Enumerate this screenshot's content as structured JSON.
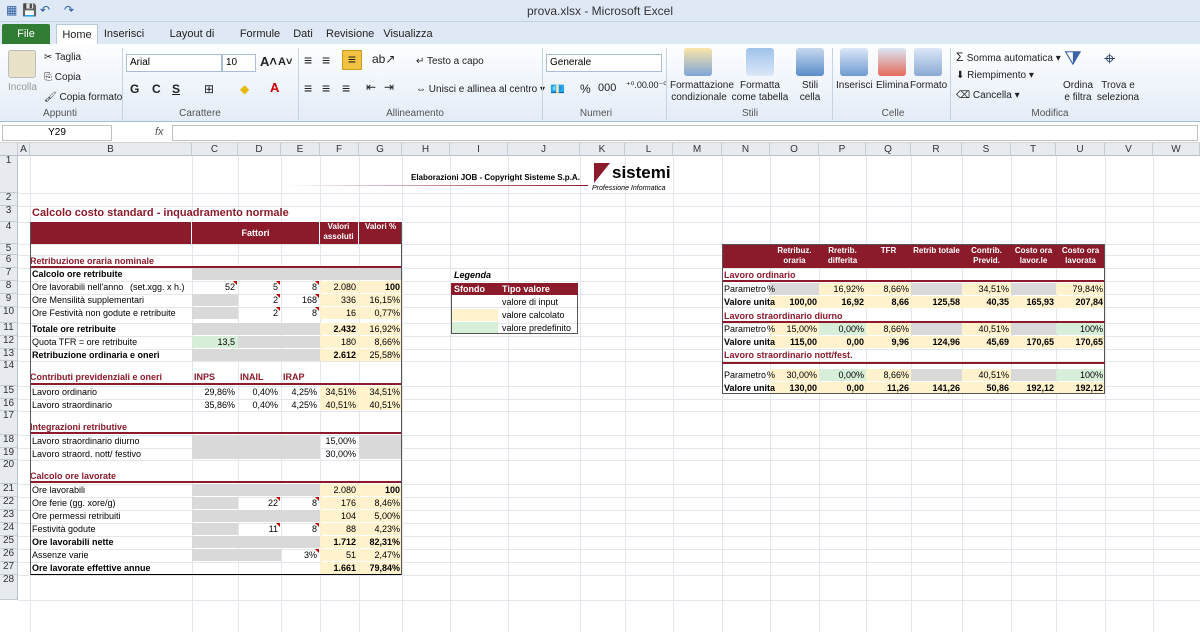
{
  "window": {
    "title": "prova.xlsx  -  Microsoft Excel"
  },
  "tabs": [
    "File",
    "Home",
    "Inserisci",
    "Layout di pagina",
    "Formule",
    "Dati",
    "Revisione",
    "Visualizza"
  ],
  "ribbon": {
    "clipboard": {
      "paste": "Incolla",
      "cut": "Taglia",
      "copy": "Copia",
      "format_painter": "Copia formato",
      "label": "Appunti"
    },
    "font": {
      "name": "Arial",
      "size": "10",
      "bold": "G",
      "italic": "C",
      "underline": "S",
      "label": "Carattere"
    },
    "alignment": {
      "wrap": "Testo a capo",
      "merge": "Unisci e allinea al centro",
      "label": "Allineamento"
    },
    "number": {
      "format": "Generale",
      "pct": "%",
      "thousands": "000",
      "label": "Numeri"
    },
    "styles": {
      "cond": "Formattazione",
      "cond2": "condizionale",
      "table": "Formatta",
      "table2": "come tabella",
      "cell": "Stili",
      "cell2": "cella",
      "label": "Stili"
    },
    "cells": {
      "insert": "Inserisci",
      "delete": "Elimina",
      "format": "Formato",
      "label": "Celle"
    },
    "editing": {
      "autosum": "Somma automatica",
      "fill": "Riempimento",
      "clear": "Cancella",
      "sort": "Ordina",
      "sort2": "e filtra",
      "find": "Trova e",
      "find2": "seleziona",
      "label": "Modifica"
    }
  },
  "formula": {
    "name_box": "Y29",
    "fx": "fx"
  },
  "columns": [
    "A",
    "B",
    "C",
    "D",
    "E",
    "F",
    "G",
    "H",
    "I",
    "J",
    "K",
    "L",
    "M",
    "N",
    "O",
    "P",
    "Q",
    "R",
    "S",
    "T",
    "U",
    "V",
    "W"
  ],
  "rows": [
    "1",
    "2",
    "3",
    "4",
    "5",
    "6",
    "7",
    "8",
    "9",
    "10",
    "11",
    "12",
    "13",
    "14",
    "15",
    "16",
    "17",
    "18",
    "19",
    "20",
    "21",
    "22",
    "23",
    "24",
    "25",
    "26",
    "27",
    "28"
  ],
  "sheet": {
    "banner": "Elaborazioni JOB - Copyright Sisteme S.p.A.",
    "logo": "sistemi",
    "logo_sub": "Professione Informatica",
    "title": "Calcolo costo standard - inquadramento normale",
    "hdr_fattori": "Fattori",
    "hdr_valori_ass": "Valori assoluti",
    "hdr_valori_pct": "Valori %",
    "s1": "Retribuzione oraria nominale",
    "r5": "Calcolo ore retribuite",
    "r6": {
      "label": "Ore lavorabili nell'anno",
      "note": "(set.xgg. x h.)",
      "c": "52",
      "d": "5",
      "e": "8",
      "f": "2.080",
      "g": "100"
    },
    "r7": {
      "label": "Ore Mensilità supplementari",
      "d": "2",
      "e": "168",
      "f": "336",
      "g": "16,15%"
    },
    "r8": {
      "label": "Ore Festività non godute e retribuite",
      "d": "2",
      "e": "8",
      "f": "16",
      "g": "0,77%"
    },
    "r9": {
      "label": "Totale ore retribuite",
      "f": "2.432",
      "g": "16,92%"
    },
    "r10": {
      "label": "Quota TFR = ore retribuite",
      "c": "13,5",
      "f": "180",
      "g": "8,66%"
    },
    "r11": {
      "label": "Retribuzione ordinaria e oneri",
      "f": "2.612",
      "g": "25,58%"
    },
    "s2": "Contributi previdenziali e oneri",
    "s2_inps": "INPS",
    "s2_inail": "INAIL",
    "s2_irap": "IRAP",
    "r13": {
      "label": "Lavoro ordinario",
      "c": "29,86%",
      "d": "0,40%",
      "e": "4,25%",
      "f": "34,51%",
      "g": "34,51%"
    },
    "r14": {
      "label": "Lavoro straordinario",
      "c": "35,86%",
      "d": "0,40%",
      "e": "4,25%",
      "f": "40,51%",
      "g": "40,51%"
    },
    "s3": "Integrazioni retributive",
    "r16": {
      "label": "Lavoro straordinario diurno",
      "f": "15,00%"
    },
    "r17": {
      "label": "Lavoro straord. nott/ festivo",
      "f": "30,00%"
    },
    "s4": "Calcolo ore lavorate",
    "r19": {
      "label": "Ore lavorabili",
      "f": "2.080",
      "g": "100"
    },
    "r20": {
      "label": "Ore ferie (gg. xore/g)",
      "d": "22",
      "e": "8",
      "f": "176",
      "g": "8,46%"
    },
    "r21": {
      "label": "Ore permessi retribuiti",
      "f": "104",
      "g": "5,00%"
    },
    "r22": {
      "label": "Festività godute",
      "d": "11",
      "e": "8",
      "f": "88",
      "g": "4,23%"
    },
    "r23": {
      "label": "Ore lavorabili nette",
      "f": "1.712",
      "g": "82,31%"
    },
    "r24": {
      "label": "Assenze varie",
      "e": "3%",
      "f": "51",
      "g": "2,47%"
    },
    "r25": {
      "label": "Ore lavorate effettive annue",
      "f": "1.661",
      "g": "79,84%"
    },
    "legend": {
      "title": "Legenda",
      "h1": "Sfondo",
      "h2": "Tipo valore",
      "l1": "valore di input",
      "l2": "valore calcolato",
      "l3": "valore predefinito"
    },
    "right": {
      "headers": [
        "Retribuz. oraria",
        "Rretrib. differita",
        "TFR",
        "Retrib totale",
        "Contrib. Previd.",
        "Costo ora lavor.le",
        "Costo ora lavorata"
      ],
      "ord_title": "Lavoro ordinario",
      "ord_param": {
        "label": "Parametro",
        "unit": "%",
        "p": "16,92%",
        "q": "8,66%",
        "s": "34,51%",
        "u": "79,84%"
      },
      "ord_val": {
        "label": "Valore unita",
        "o": "100,00",
        "p": "16,92",
        "q": "8,66",
        "r": "125,58",
        "s": "40,35",
        "t": "165,93",
        "u": "207,84"
      },
      "diu_title": "Lavoro straordinario diurno",
      "diu_param": {
        "label": "Parametro",
        "unit": "%",
        "o": "15,00%",
        "p": "0,00%",
        "q": "8,66%",
        "s": "40,51%",
        "u": "100%"
      },
      "diu_val": {
        "label": "Valore unita",
        "o": "115,00",
        "p": "0,00",
        "q": "9,96",
        "r": "124,96",
        "s": "45,69",
        "t": "170,65",
        "u": "170,65"
      },
      "not_title": "Lavoro straordinario nott/fest.",
      "not_param": {
        "label": "Parametro",
        "unit": "%",
        "o": "30,00%",
        "p": "0,00%",
        "q": "8,66%",
        "s": "40,51%",
        "u": "100%"
      },
      "not_val": {
        "label": "Valore unita",
        "o": "130,00",
        "p": "0,00",
        "q": "11,26",
        "r": "141,26",
        "s": "50,86",
        "t": "192,12",
        "u": "192,12"
      }
    }
  }
}
